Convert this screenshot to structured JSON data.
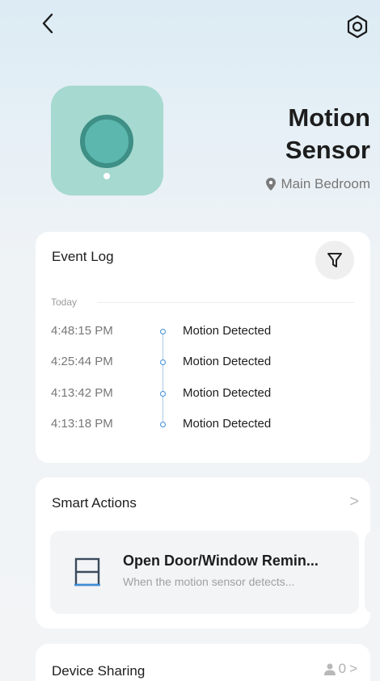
{
  "header": {
    "back_icon": "chevron-left-icon",
    "settings_icon": "hexagon-settings-icon"
  },
  "device": {
    "name_line1": "Motion",
    "name_line2": "Sensor",
    "location": "Main Bedroom",
    "icon_color": "#a6d9cf"
  },
  "event_log": {
    "title": "Event Log",
    "day_label": "Today",
    "events": [
      {
        "time": "4:48:15 PM",
        "text": "Motion Detected"
      },
      {
        "time": "4:25:44 PM",
        "text": "Motion Detected"
      },
      {
        "time": "4:13:42 PM",
        "text": "Motion Detected"
      },
      {
        "time": "4:13:18 PM",
        "text": "Motion Detected"
      }
    ]
  },
  "smart_actions": {
    "title": "Smart Actions",
    "chevron": ">",
    "items": [
      {
        "title": "Open Door/Window Remin...",
        "description": "When the motion sensor detects..."
      }
    ]
  },
  "device_sharing": {
    "title": "Device Sharing",
    "count": "0",
    "chevron": ">"
  },
  "colors": {
    "accent_blue": "#3d8ed6",
    "device_teal": "#5cb8ae"
  }
}
